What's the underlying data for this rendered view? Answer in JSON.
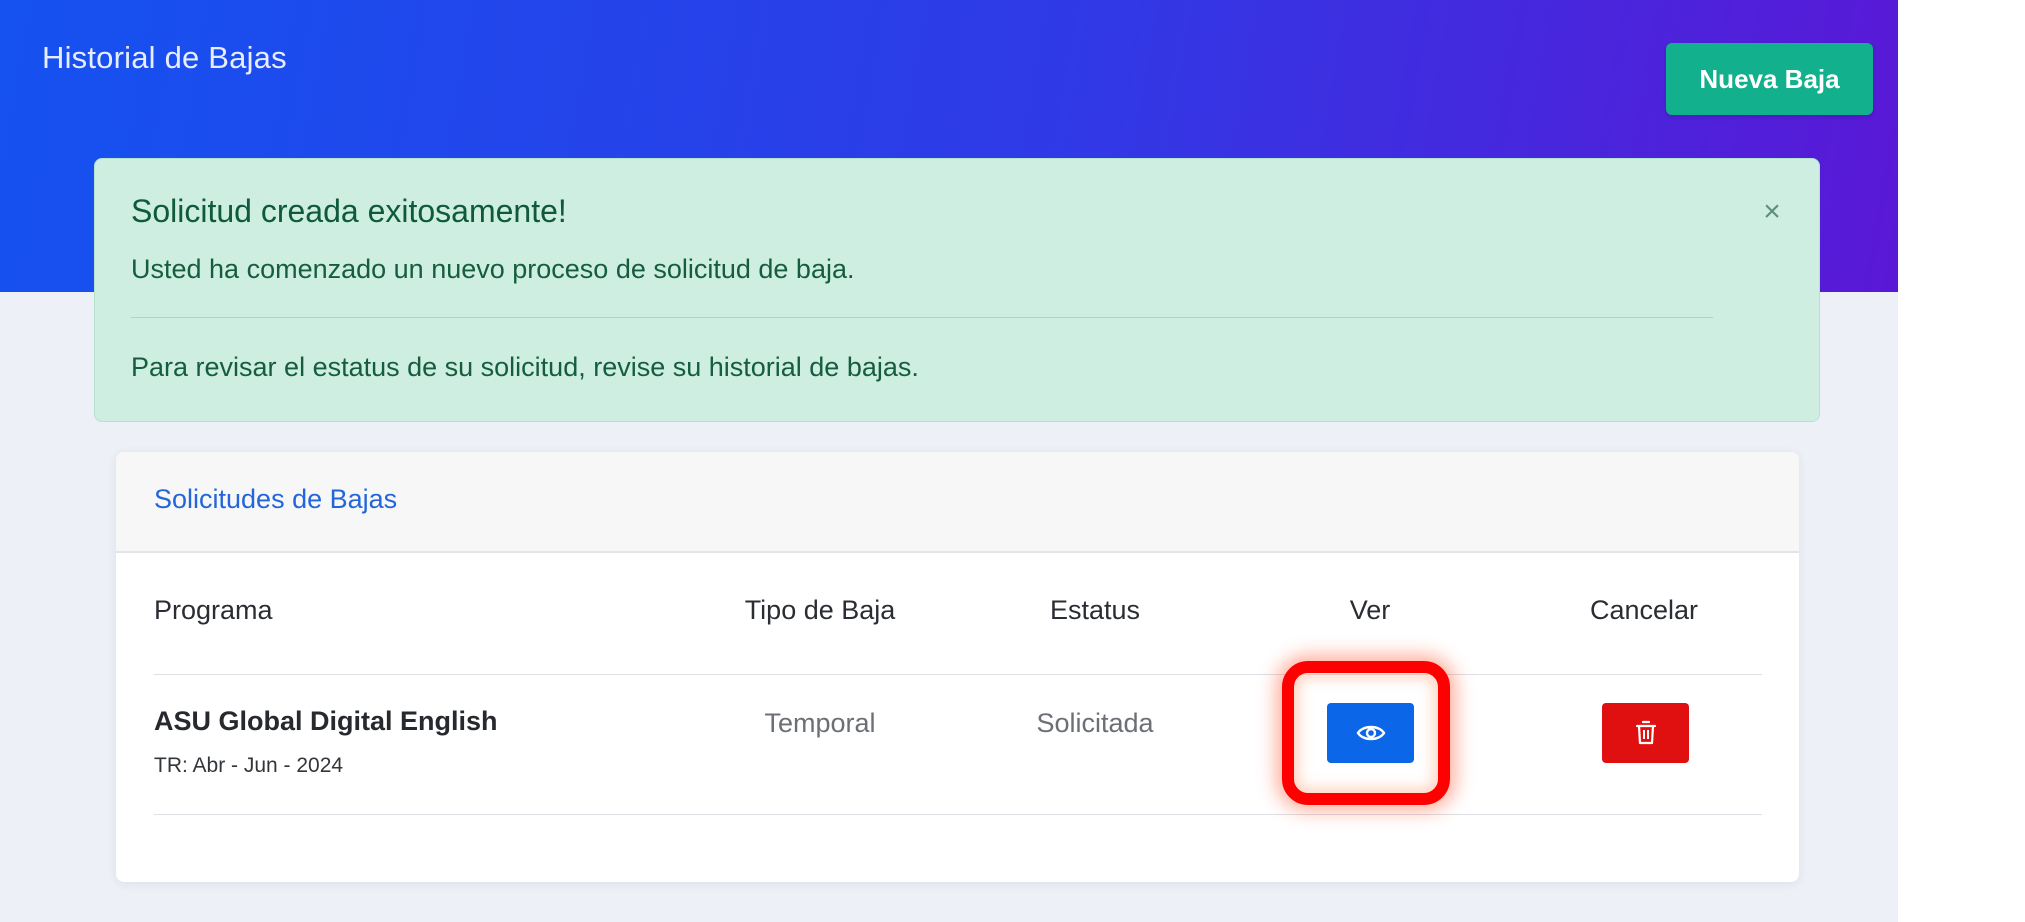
{
  "header": {
    "title": "Historial de Bajas",
    "new_button_label": "Nueva Baja"
  },
  "alert": {
    "heading": "Solicitud creada exitosamente!",
    "body": "Usted ha comenzado un nuevo proceso de solicitud de baja.",
    "footer": "Para revisar el estatus de su solicitud, revise su historial de bajas.",
    "close_glyph": "×"
  },
  "card": {
    "title": "Solicitudes de Bajas",
    "columns": [
      "Programa",
      "Tipo de Baja",
      "Estatus",
      "Ver",
      "Cancelar"
    ],
    "rows": [
      {
        "program": "ASU Global Digital English",
        "period": "TR: Abr - Jun - 2024",
        "type": "Temporal",
        "status": "Solicitada",
        "view_icon": "eye-icon",
        "delete_icon": "trash-icon"
      }
    ]
  },
  "colors": {
    "hero_gradient_start": "#1552f0",
    "hero_gradient_end": "#5a18d6",
    "new_button": "#12b08c",
    "alert_background": "#cdeee0",
    "view_button": "#0b67e8",
    "delete_button": "#e01010",
    "highlight": "#ff0000"
  }
}
